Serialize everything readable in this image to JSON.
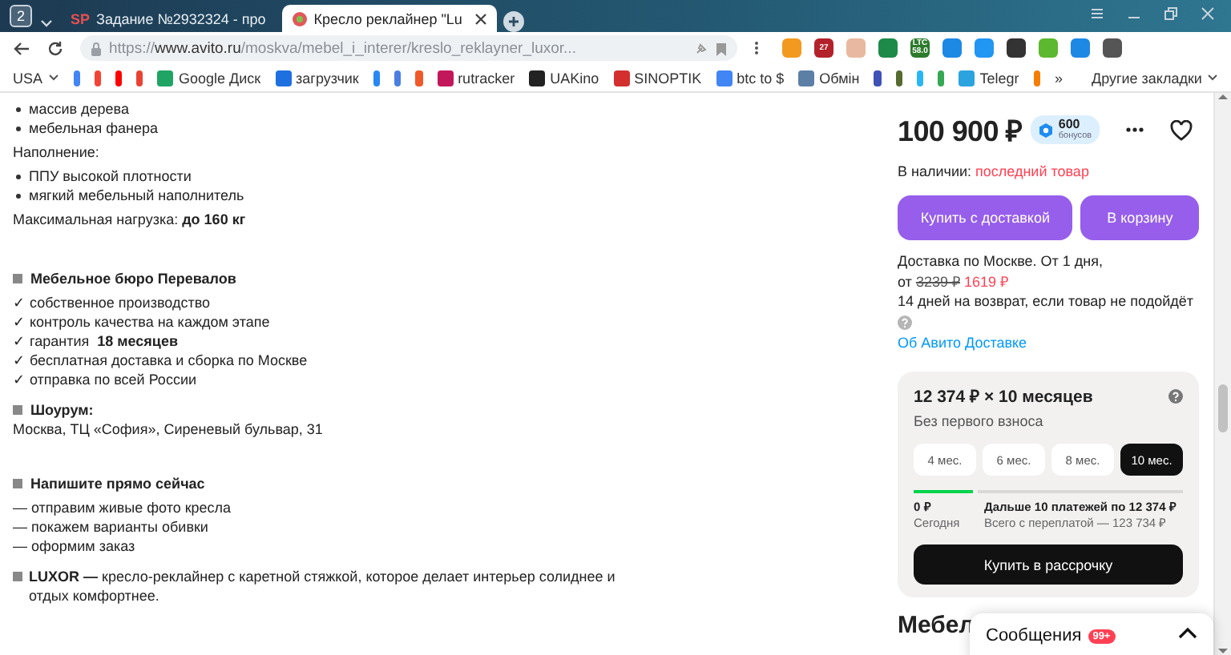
{
  "browser": {
    "tab_count": "2",
    "tabs": [
      {
        "title": "Задание №2932324 - про",
        "selected": false,
        "icon_text": "SP"
      },
      {
        "title": "Кресло реклайнер \"Lu",
        "selected": true
      }
    ],
    "address": {
      "scheme": "https://",
      "host": "www.avito.ru",
      "path": "/moskva/mebel_i_interer/kreslo_reklayner_luxor..."
    },
    "extensions": [
      {
        "color": "#f29a1f"
      },
      {
        "color": "#b3222a",
        "text": "27"
      },
      {
        "color": "#e8b9a0"
      },
      {
        "color": "#1e8a4a"
      },
      {
        "color": "#2c7a2c",
        "text": "LTC 58.0"
      },
      {
        "color": "#1e88e5"
      },
      {
        "color": "#2196f3"
      },
      {
        "color": "#333333"
      },
      {
        "color": "#5cb82e"
      },
      {
        "color": "#1e88e5"
      },
      {
        "color": "#555555"
      }
    ],
    "bookmarks": [
      {
        "label": "USA",
        "kind": "folder"
      },
      {
        "color": "#4285f4",
        "kind": "icon"
      },
      {
        "color": "#f44336",
        "kind": "icon"
      },
      {
        "color": "#ff0000",
        "kind": "icon"
      },
      {
        "color": "#ea4335",
        "kind": "icon"
      },
      {
        "label": "Google Диск",
        "color": "#1fa463",
        "kind": "link"
      },
      {
        "label": "загрузчик",
        "color": "#1e6fe0",
        "kind": "link"
      },
      {
        "color": "#2787f5",
        "kind": "icon"
      },
      {
        "color": "#4a7fe0",
        "kind": "icon"
      },
      {
        "color": "#f05a28",
        "kind": "icon"
      },
      {
        "label": "rutracker",
        "color": "#c2185b",
        "kind": "link"
      },
      {
        "label": "UAKino",
        "color": "#222222",
        "kind": "link"
      },
      {
        "label": "SINOPTIK",
        "color": "#d32f2f",
        "kind": "link"
      },
      {
        "label": "btc to $",
        "color": "#4285f4",
        "kind": "link"
      },
      {
        "label": "Обмін",
        "color": "#5c7fa6",
        "kind": "link"
      },
      {
        "color": "#3f51b5",
        "kind": "icon"
      },
      {
        "color": "#556b2f",
        "kind": "icon"
      },
      {
        "color": "#29b6f6",
        "kind": "icon"
      },
      {
        "color": "#34a853",
        "kind": "icon"
      },
      {
        "label": "Telegr",
        "color": "#2aa3de",
        "kind": "link"
      },
      {
        "color": "#f57d00",
        "kind": "icon"
      },
      {
        "label": "»",
        "kind": "more"
      },
      {
        "label": "Другие закладки",
        "kind": "folder"
      }
    ]
  },
  "description": [
    {
      "kind": "bullet",
      "text": "массив дерева"
    },
    {
      "kind": "bullet",
      "text": "мебельная фанера"
    },
    {
      "kind": "para",
      "text": "Наполнение:"
    },
    {
      "kind": "bullet",
      "text": "ППУ высокой плотности"
    },
    {
      "kind": "bullet",
      "text": "мягкий мебельный наполнитель"
    },
    {
      "kind": "para",
      "text": "Максимальная нагрузка: **до 160 кг**"
    },
    {
      "kind": "heading",
      "text": "Мебельное бюро Перевалов"
    },
    {
      "kind": "line",
      "text": "✓ собственное производство"
    },
    {
      "kind": "line",
      "text": "✓ контроль качества на каждом этапе"
    },
    {
      "kind": "line",
      "text": "✓ гарантия **18 месяцев**"
    },
    {
      "kind": "line",
      "text": "✓ бесплатная доставка и сборка по Москве"
    },
    {
      "kind": "line",
      "text": "✓ отправка по всей России"
    },
    {
      "kind": "subheading",
      "text": "Шоурум:"
    },
    {
      "kind": "line",
      "text": "Москва, ТЦ «София», Сиреневый бульвар, 31"
    },
    {
      "kind": "heading",
      "text": "Напишите прямо сейчас"
    },
    {
      "kind": "line",
      "text": "— отправим живые фото кресла"
    },
    {
      "kind": "line",
      "text": "— покажем варианты обивки"
    },
    {
      "kind": "line",
      "text": "— оформим заказ"
    },
    {
      "kind": "marked",
      "text": "**LUXOR —** кресло-реклайнер с каретной стяжкой, которое делает интерьер солиднее и отдых комфортнее."
    }
  ],
  "offer": {
    "price": "100 900 ₽",
    "bonus": {
      "amount": "600",
      "label": "бонусов"
    },
    "favorite": false,
    "stock_label": "В наличии:",
    "stock_value": "последний товар",
    "buttons": [
      {
        "label": "Купить с доставкой"
      },
      {
        "label": "В корзину"
      }
    ],
    "delivery": "Доставка по Москве. От 1 дня,",
    "delivery_from": "от",
    "old_price": "3239 ₽",
    "new_price": "1619 ₽",
    "returns": "14 дней на возврат, если товар не подойдёт",
    "delivery_link": "Об Авито Доставке"
  },
  "installment": {
    "title": "12 374 ₽ × 10 месяцев",
    "subtitle": "Без первого взноса",
    "terms": [
      {
        "label": "4 мес.",
        "selected": false
      },
      {
        "label": "6 мес.",
        "selected": false
      },
      {
        "label": "8 мес.",
        "selected": false
      },
      {
        "label": "10 мес.",
        "selected": true
      }
    ],
    "progress": {
      "level": 0.22
    },
    "today_amount": "0 ₽",
    "today_label": "Сегодня",
    "next": "Дальше 10 платежей по 12 374 ₽",
    "total": "Всего с переплатой — 123 734 ₽",
    "button": "Купить в рассрочку"
  },
  "seller_heading": "Мебел",
  "messages": {
    "label": "Сообщения",
    "badge": "99+"
  }
}
